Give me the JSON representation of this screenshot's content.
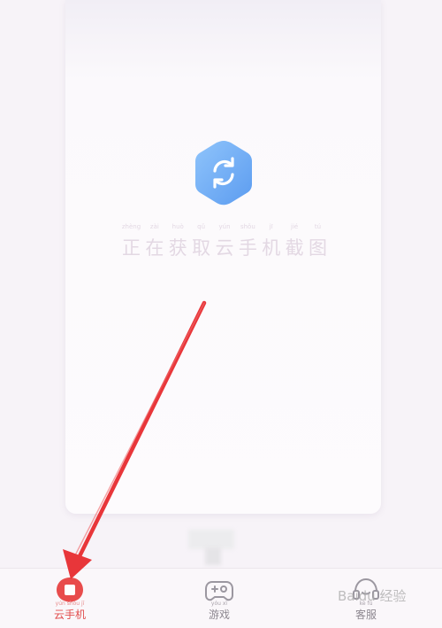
{
  "loading": {
    "icon": "refresh-icon",
    "pinyin": [
      "zhèng",
      "zài",
      "huò",
      "qǔ",
      "yún",
      "shǒu",
      "jī",
      "jié",
      "tú"
    ],
    "text": [
      "正",
      "在",
      "获",
      "取",
      "云",
      "手",
      "机",
      "截",
      "图"
    ]
  },
  "tabs": [
    {
      "pinyin": "yún shǒu jī",
      "label": "云手机",
      "icon": "cloud-phone-icon",
      "active": true
    },
    {
      "pinyin": "yóu xì",
      "label": "游戏",
      "icon": "gamepad-icon",
      "active": false
    },
    {
      "pinyin": "kè fú",
      "label": "客服",
      "icon": "headset-icon",
      "active": false
    }
  ],
  "watermark": {
    "text": "Baidu 经验"
  },
  "colors": {
    "accent": "#e14c4c",
    "loading_blue": "#6aaaf3",
    "arrow": "#e8363a"
  }
}
